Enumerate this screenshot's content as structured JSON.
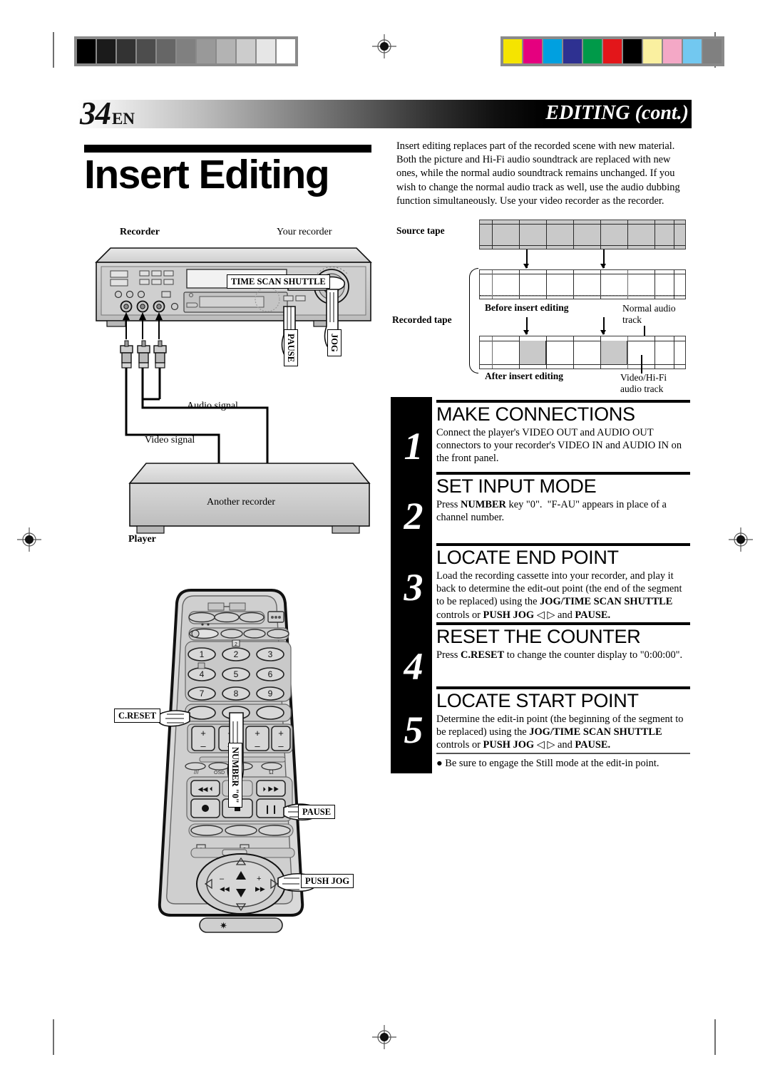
{
  "header": {
    "page_number": "34",
    "page_locale": "EN",
    "section_title": "EDITING (cont.)"
  },
  "title": "Insert Editing",
  "intro": "Insert editing replaces part of the recorded scene with new material. Both the picture and Hi-Fi audio soundtrack are replaced with new ones, while the normal audio soundtrack remains unchanged. If you wish to change the normal audio track as well, use the audio dubbing function simultaneously. Use your video recorder as the recorder.",
  "tape_diagram": {
    "source_tape_label": "Source tape",
    "recorded_tape_label": "Recorded tape",
    "before_label": "Before insert editing",
    "after_label": "After insert editing",
    "normal_audio_label_line1": "Normal audio",
    "normal_audio_label_line2": "track",
    "video_hifi_label_line1": "Video/Hi-Fi",
    "video_hifi_label_line2": "audio track"
  },
  "connection_diagram": {
    "recorder_label": "Recorder",
    "your_recorder_label": "Your recorder",
    "audio_signal_label": "Audio signal",
    "video_signal_label": "Video signal",
    "another_recorder_label": "Another recorder",
    "player_label": "Player",
    "callouts": {
      "time_scan_shuttle": "TIME SCAN SHUTTLE",
      "pause": "PAUSE",
      "jog": "JOG"
    }
  },
  "remote_diagram": {
    "keys": [
      "1",
      "2",
      "3",
      "4",
      "5",
      "6",
      "7",
      "8",
      "9"
    ],
    "callouts": {
      "c_reset": "C.RESET",
      "number_zero": "NUMBER \"0\"",
      "pause": "PAUSE",
      "push_jog": "PUSH JOG"
    }
  },
  "steps": [
    {
      "number": "1",
      "heading": "MAKE CONNECTIONS",
      "text": "Connect the player's VIDEO OUT and AUDIO OUT connectors to your recorder's VIDEO IN and AUDIO IN on the front panel."
    },
    {
      "number": "2",
      "heading": "SET INPUT MODE",
      "text": "Press NUMBER key \"0\".  \"F-AU\" appears in place of a channel number."
    },
    {
      "number": "3",
      "heading": "LOCATE END POINT",
      "text": "Load the recording cassette into your recorder, and play it back to determine the edit-out point (the end of the segment to be replaced) using the JOG/TIME SCAN SHUTTLE controls or PUSH JOG ◁ ▷ and PAUSE."
    },
    {
      "number": "4",
      "heading": "RESET THE COUNTER",
      "text": "Press C.RESET to change the counter display to \"0:00:00\"."
    },
    {
      "number": "5",
      "heading": "LOCATE START POINT",
      "text": "Determine the edit-in point (the beginning of the segment to be replaced) using the JOG/TIME SCAN SHUTTLE controls or PUSH JOG ◁ ▷ and PAUSE."
    }
  ],
  "note": "Be sure to engage the Still mode at the edit-in point.",
  "calibration": {
    "grayscale": [
      "#000000",
      "#1b1b1b",
      "#333333",
      "#4d4d4d",
      "#666666",
      "#808080",
      "#999999",
      "#b3b3b3",
      "#cccccc",
      "#e6e6e6",
      "#ffffff"
    ],
    "colors": [
      "#f5e400",
      "#e5007f",
      "#00a0e0",
      "#2e3191",
      "#009a49",
      "#e3161a",
      "#000000",
      "#faf0a0",
      "#f4a8c6",
      "#72c8f0",
      "#808080"
    ]
  }
}
